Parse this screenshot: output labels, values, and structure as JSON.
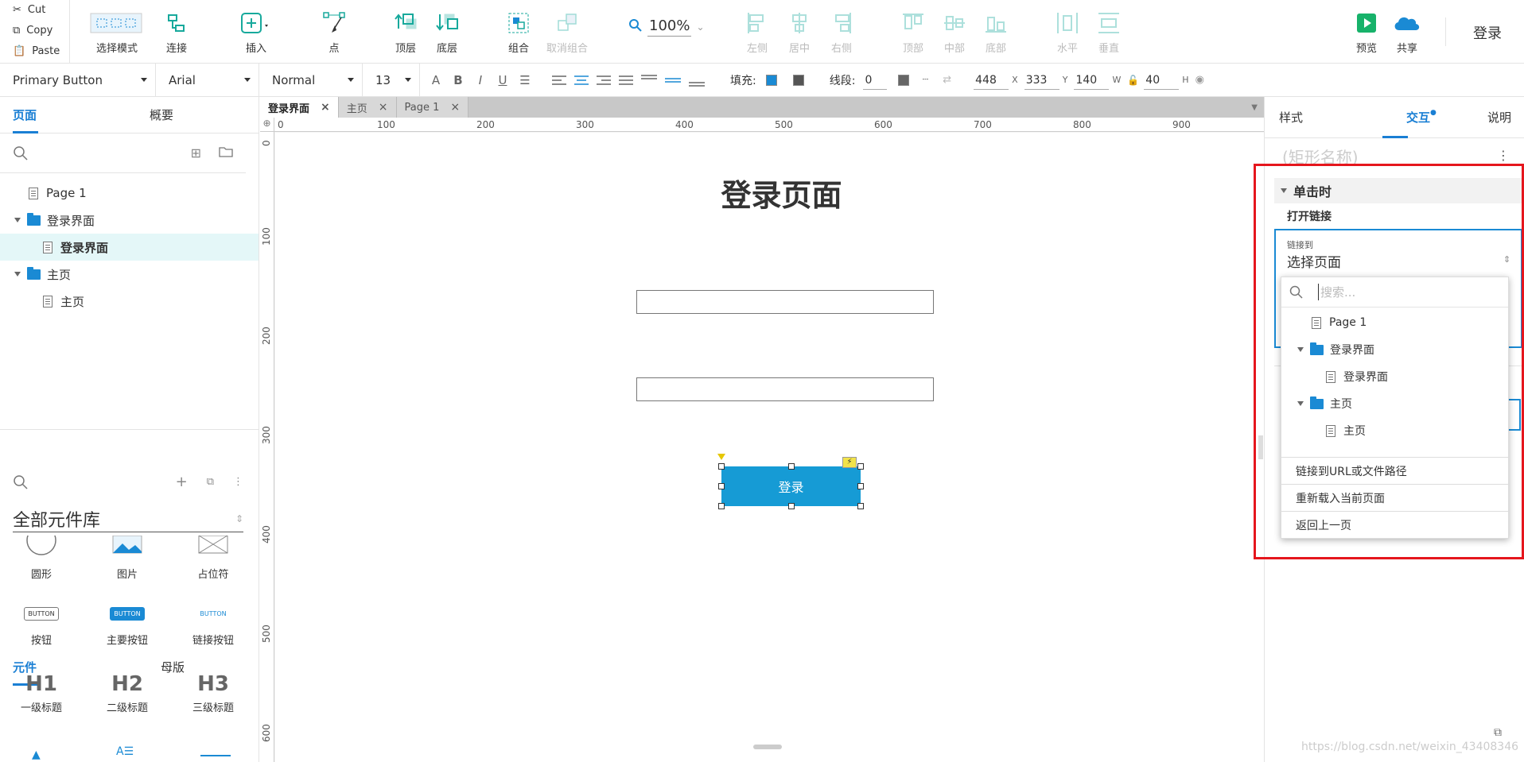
{
  "toolbar": {
    "clipboard": {
      "cut": "Cut",
      "copy": "Copy",
      "paste": "Paste"
    },
    "buttons": {
      "select_mode": "选择模式",
      "connect": "连接",
      "insert": "插入",
      "point": "点",
      "top_layer": "顶层",
      "bottom_layer": "底层",
      "group": "组合",
      "ungroup": "取消组合",
      "align_left": "左侧",
      "align_center": "居中",
      "align_right": "右侧",
      "align_top": "顶部",
      "align_middle": "中部",
      "align_bottom": "底部",
      "distribute_h": "水平",
      "distribute_v": "垂直",
      "preview": "预览",
      "share": "共享",
      "login": "登录"
    },
    "zoom": "100%"
  },
  "format": {
    "style": "Primary Button",
    "font": "Arial",
    "weight": "Normal",
    "size": "13",
    "fill_label": "填充:",
    "stroke_label": "线段:",
    "stroke_value": "0",
    "x": "448",
    "x_label": "X",
    "y": "333",
    "y_label": "Y",
    "w": "140",
    "w_label": "W",
    "h": "40",
    "h_label": "H"
  },
  "left_panel": {
    "tabs": [
      "页面",
      "概要"
    ],
    "pages": [
      {
        "label": "Page 1",
        "type": "page"
      },
      {
        "label": "登录界面",
        "type": "folder"
      },
      {
        "label": "登录界面",
        "type": "page",
        "selected": true
      },
      {
        "label": "主页",
        "type": "folder"
      },
      {
        "label": "主页",
        "type": "page"
      }
    ],
    "lib_tabs": [
      "元件",
      "母版"
    ],
    "library_title": "全部元件库",
    "widgets": [
      {
        "label": "圆形"
      },
      {
        "label": "图片"
      },
      {
        "label": "占位符"
      },
      {
        "label": "按钮",
        "thumb": "BUTTON"
      },
      {
        "label": "主要按钮",
        "thumb": "BUTTON"
      },
      {
        "label": "链接按钮",
        "thumb": "BUTTON"
      },
      {
        "label": "一级标题",
        "thumb": "H1"
      },
      {
        "label": "二级标题",
        "thumb": "H2"
      },
      {
        "label": "三级标题",
        "thumb": "H3"
      }
    ]
  },
  "doc_tabs": [
    "登录界面",
    "主页",
    "Page 1"
  ],
  "ruler": {
    "h": [
      "0",
      "100",
      "200",
      "300",
      "400",
      "500",
      "600",
      "700",
      "800",
      "900"
    ],
    "v": [
      "0",
      "100",
      "200",
      "300",
      "400",
      "500",
      "600"
    ]
  },
  "canvas": {
    "heading": "登录页面",
    "button_label": "登录"
  },
  "right_panel": {
    "tabs": [
      "样式",
      "交互",
      "说明"
    ],
    "shape_name_placeholder": "(矩形名称)",
    "event": "单击时",
    "action": "打开链接",
    "link_to_label": "链接到",
    "link_select": "选择页面",
    "search_placeholder": "搜索...",
    "dropdown_pages": [
      {
        "label": "Page 1",
        "type": "page",
        "level": 0
      },
      {
        "label": "登录界面",
        "type": "folder",
        "level": 0
      },
      {
        "label": "登录界面",
        "type": "page",
        "level": 1
      },
      {
        "label": "主页",
        "type": "folder",
        "level": 0
      },
      {
        "label": "主页",
        "type": "page",
        "level": 1
      }
    ],
    "dropdown_actions": [
      "链接到URL或文件路径",
      "重新载入当前页面",
      "返回上一页"
    ]
  },
  "watermark": "https://blog.csdn.net/weixin_43408346",
  "colors": {
    "accent": "#1a7fd4",
    "button": "#169bd5",
    "highlight": "#e5161d"
  }
}
